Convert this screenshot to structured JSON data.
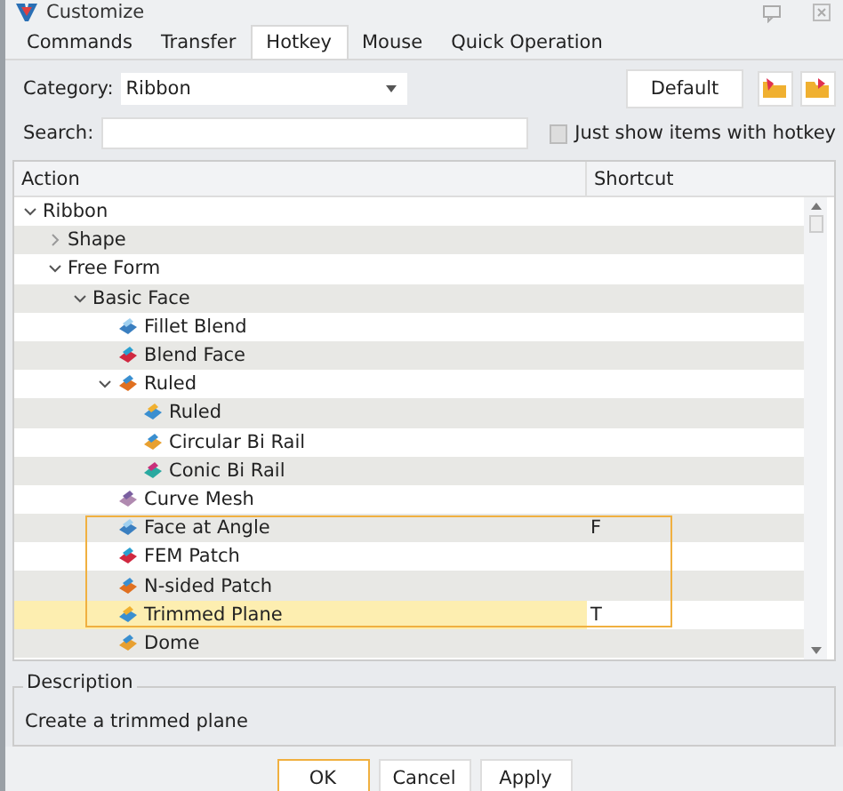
{
  "window": {
    "title": "Customize"
  },
  "tabs": [
    {
      "label": "Commands",
      "selected": false
    },
    {
      "label": "Transfer",
      "selected": false
    },
    {
      "label": "Hotkey",
      "selected": true
    },
    {
      "label": "Mouse",
      "selected": false
    },
    {
      "label": "Quick Operation",
      "selected": false
    }
  ],
  "category": {
    "label": "Category:",
    "value": "Ribbon"
  },
  "default_button": "Default",
  "search": {
    "label": "Search:"
  },
  "hotkey_filter": {
    "label": "Just show items with hotkey",
    "checked": false
  },
  "table": {
    "columns": [
      "Action",
      "Shortcut"
    ],
    "tree": [
      {
        "label": "Ribbon",
        "expanded": true,
        "selected": false,
        "children": [
          {
            "label": "Shape",
            "expanded": false,
            "selected": false
          },
          {
            "label": "Free Form",
            "expanded": true,
            "selected": false,
            "children": [
              {
                "label": "Basic Face",
                "expanded": true,
                "selected": false,
                "children": [
                  {
                    "label": "Fillet Blend",
                    "selected": false
                  },
                  {
                    "label": "Blend Face",
                    "selected": false
                  },
                  {
                    "label": "Ruled",
                    "expanded": true,
                    "selected": false,
                    "children": [
                      {
                        "label": "Ruled",
                        "selected": false
                      },
                      {
                        "label": "Circular Bi Rail",
                        "selected": false
                      },
                      {
                        "label": "Conic Bi Rail",
                        "selected": false
                      }
                    ]
                  },
                  {
                    "label": "Curve Mesh",
                    "selected": false
                  },
                  {
                    "label": "Face at Angle",
                    "shortcut": "F",
                    "selected": false,
                    "highlighted": true
                  },
                  {
                    "label": "FEM Patch",
                    "selected": false,
                    "highlighted": true
                  },
                  {
                    "label": "N-sided Patch",
                    "selected": false,
                    "highlighted": true
                  },
                  {
                    "label": "Trimmed Plane",
                    "shortcut": "T",
                    "selected": true,
                    "highlighted": true
                  },
                  {
                    "label": "Dome",
                    "selected": false
                  }
                ]
              }
            ]
          }
        ]
      }
    ]
  },
  "description": {
    "title": "Description",
    "text": "Create a trimmed plane"
  },
  "buttons": [
    {
      "label": "OK",
      "default": true
    },
    {
      "label": "Cancel",
      "default": false
    },
    {
      "label": "Apply",
      "default": false
    }
  ]
}
